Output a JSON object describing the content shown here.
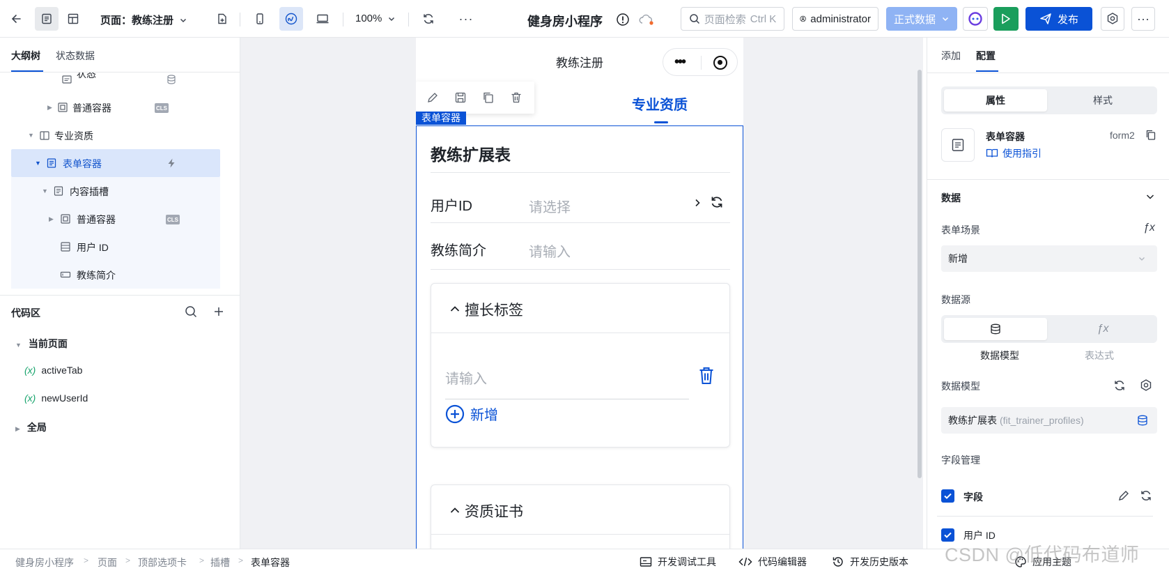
{
  "toolbar": {
    "page_label": "页面：教练注册",
    "zoom": "100%",
    "app_title": "健身房小程序",
    "search_placeholder": "页面检索",
    "search_shortcut": "Ctrl K",
    "user": "administrator",
    "data_mode": "正式数据",
    "publish": "发布"
  },
  "left": {
    "tabs": [
      "大纲树",
      "状态数据"
    ],
    "tree": [
      {
        "label": "状态"
      },
      {
        "label": "普通容器",
        "badge": "CLS"
      },
      {
        "label": "专业资质"
      },
      {
        "label": "表单容器"
      },
      {
        "label": "内容插槽"
      },
      {
        "label": "普通容器",
        "badge": "CLS"
      },
      {
        "label": "用户 ID"
      },
      {
        "label": "教练简介"
      }
    ],
    "code": {
      "title": "代码区",
      "current_page": "当前页面",
      "vars": [
        "activeTab",
        "newUserId"
      ],
      "var_prefix": "(x)",
      "global": "全局"
    }
  },
  "phone": {
    "nav_title": "教练注册",
    "active_tab": "专业资质",
    "form_tag": "表单容器",
    "form_title": "教练扩展表",
    "fields": [
      {
        "label": "用户ID",
        "placeholder": "请选择"
      },
      {
        "label": "教练简介",
        "placeholder": "请输入"
      }
    ],
    "card1": {
      "title": "擅长标签",
      "input_placeholder": "请输入",
      "add_label": "新增"
    },
    "card2": {
      "title": "资质证书"
    }
  },
  "right": {
    "tabs": [
      "添加",
      "配置"
    ],
    "seg": [
      "属性",
      "样式"
    ],
    "component": {
      "name": "表单容器",
      "id": "form2",
      "guide": "使用指引"
    },
    "data_section": "数据",
    "form_scene_label": "表单场景",
    "form_scene_value": "新增",
    "datasource_label": "数据源",
    "datasource_options": [
      "数据模型",
      "表达式"
    ],
    "model_label": "数据模型",
    "model_value": "教练扩展表",
    "model_code": "(fit_trainer_profiles)",
    "fields_label": "字段管理",
    "field_group": "字段",
    "field_item": "用户 ID"
  },
  "bottom": {
    "crumbs": [
      "健身房小程序",
      "页面",
      "顶部选项卡",
      "插槽",
      "表单容器"
    ],
    "tools": [
      "开发调试工具",
      "代码编辑器",
      "开发历史版本",
      "应用主题"
    ]
  },
  "watermark": "CSDN @低代码布道师",
  "colors": {
    "primary": "#0a52d6",
    "run": "#1a9e5c",
    "data_button": "#8fb3f4"
  }
}
